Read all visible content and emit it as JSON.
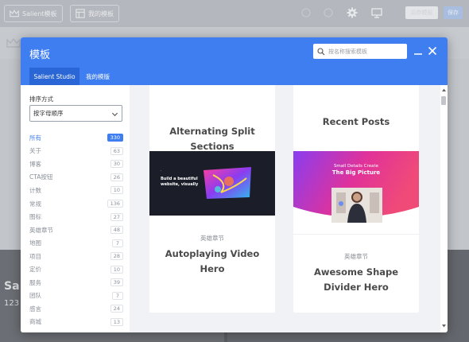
{
  "background": {
    "brand_button": "Salient模板",
    "my_templates_button": "我的模板",
    "save_button": "另存模板",
    "blue_button": "保存",
    "hero_title": "Sa",
    "hero_sub": "123"
  },
  "modal": {
    "title": "模板",
    "search_placeholder": "按名称搜索模板",
    "tabs": [
      {
        "label": "Salient Studio"
      },
      {
        "label": "我的模版"
      }
    ],
    "sort": {
      "label": "排序方式",
      "value": "按字母顺序"
    },
    "categories": [
      {
        "name": "所有",
        "count": "330"
      },
      {
        "name": "关于",
        "count": "63"
      },
      {
        "name": "博客",
        "count": "30"
      },
      {
        "name": "CTA按钮",
        "count": "26"
      },
      {
        "name": "计数",
        "count": "10"
      },
      {
        "name": "常规",
        "count": "136"
      },
      {
        "name": "图标",
        "count": "27"
      },
      {
        "name": "英雄章节",
        "count": "48"
      },
      {
        "name": "地图",
        "count": "7"
      },
      {
        "name": "项目",
        "count": "28"
      },
      {
        "name": "定价",
        "count": "10"
      },
      {
        "name": "服务",
        "count": "39"
      },
      {
        "name": "团队",
        "count": "7"
      },
      {
        "name": "感言",
        "count": "24"
      },
      {
        "name": "商城",
        "count": "13"
      }
    ],
    "cards": [
      {
        "title_line1": "Alternating Split",
        "title_line2": "Sections"
      },
      {
        "title_line1": "Recent Posts"
      },
      {
        "category": "英雄章节",
        "title_line1": "Autoplaying Video",
        "title_line2": "Hero",
        "thumb_text": "Build a beautiful website, visually"
      },
      {
        "category": "英雄章节",
        "title_line1": "Awesome Shape",
        "title_line2": "Divider Hero",
        "thumb_text_line1": "Small Details Create",
        "thumb_text_line2": "The Big Picture"
      }
    ]
  },
  "colors": {
    "accent": "#3f7ef0",
    "tab_active": "#2a66d6"
  }
}
